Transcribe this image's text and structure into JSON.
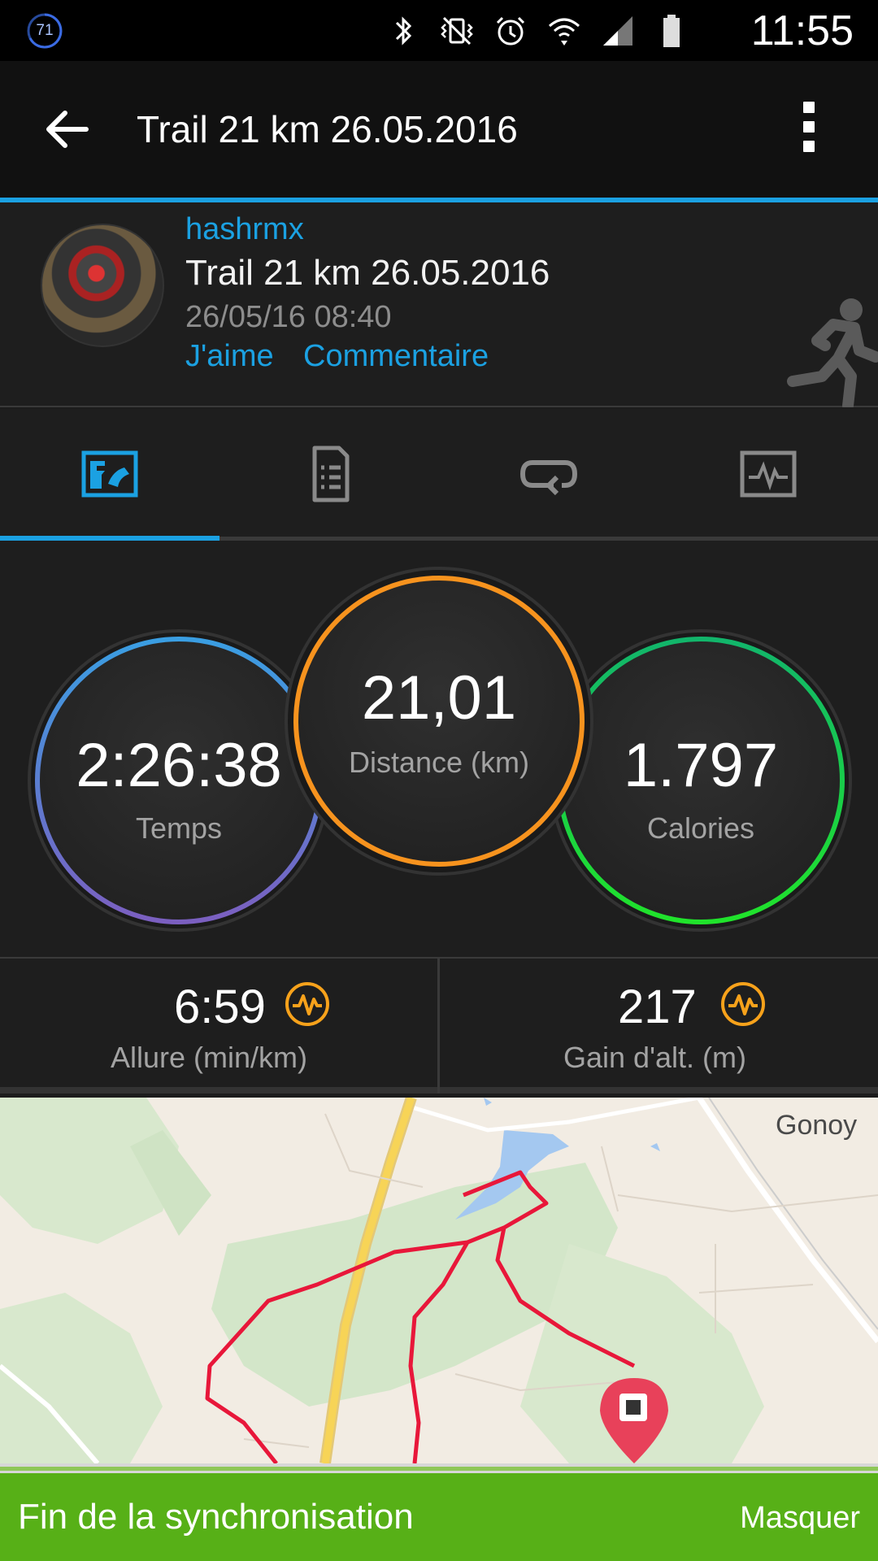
{
  "status_bar": {
    "battery_percent": "71",
    "time": "11:55",
    "icons": [
      "bluetooth-icon",
      "vibrate-icon",
      "alarm-icon",
      "wifi-icon",
      "signal-icon",
      "battery-icon"
    ]
  },
  "app_bar": {
    "title": "Trail 21 km 26.05.2016"
  },
  "activity": {
    "user": "hashrmx",
    "title": "Trail 21 km 26.05.2016",
    "date": "26/05/16 08:40",
    "like_label": "J'aime",
    "comment_label": "Commentaire",
    "type_icon": "running-icon"
  },
  "tabs": [
    {
      "icon": "overview-icon",
      "active": true
    },
    {
      "icon": "details-icon",
      "active": false
    },
    {
      "icon": "laps-icon",
      "active": false
    },
    {
      "icon": "charts-icon",
      "active": false
    }
  ],
  "summary": {
    "time": {
      "value": "2:26:38",
      "label": "Temps"
    },
    "distance": {
      "value": "21,01",
      "label": "Distance (km)"
    },
    "calories": {
      "value": "1.797",
      "label": "Calories"
    },
    "colors": {
      "time": "#3a9ee2",
      "time_end": "#7b5fc0",
      "distance": "#f7931e",
      "calories": "#20c33b",
      "calories_end": "#12b56b"
    }
  },
  "metrics": {
    "pace": {
      "value": "6:59",
      "label": "Allure (min/km)"
    },
    "elevation": {
      "value": "217",
      "label": "Gain d'alt. (m)"
    },
    "accent": "#f7a21b"
  },
  "map": {
    "place_label": "Gonoy",
    "route_color": "#e8173a"
  },
  "sync_banner": {
    "message": "Fin de la synchronisation",
    "action": "Masquer",
    "color": "#57b017"
  }
}
